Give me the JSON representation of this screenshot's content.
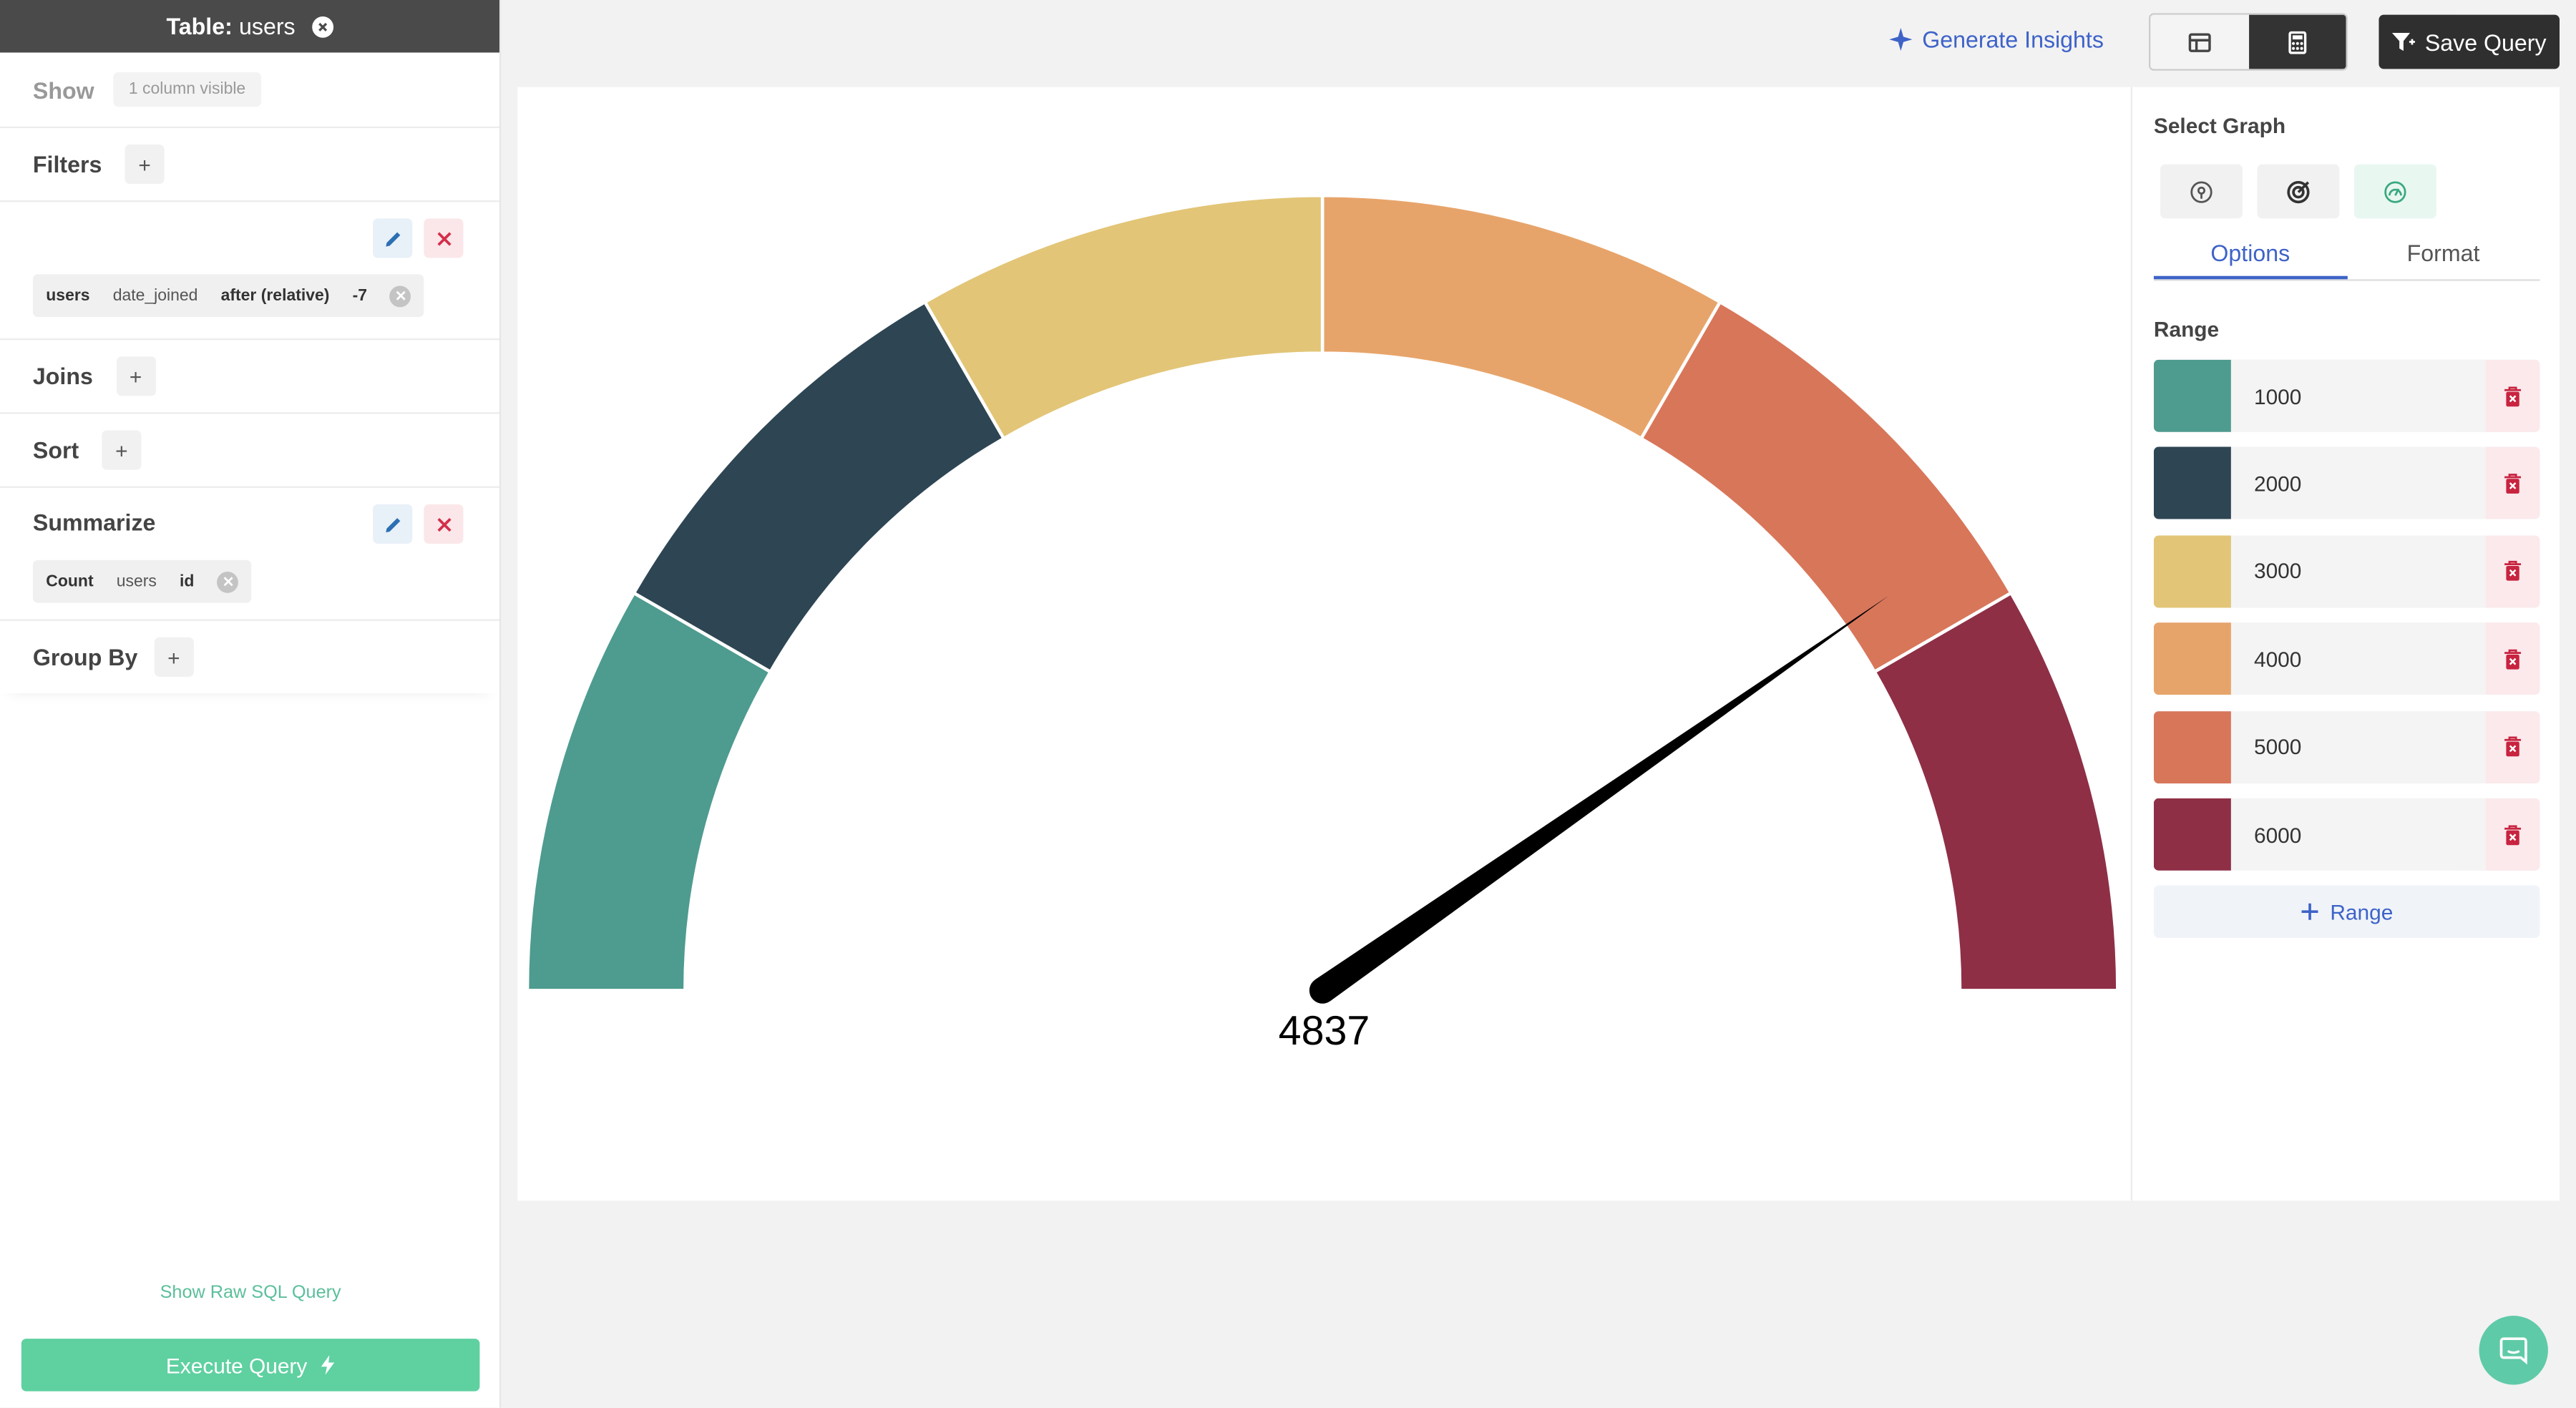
{
  "sidebar": {
    "table_prefix": "Table:",
    "table_name": "users",
    "show_label": "Show",
    "show_value": "1 column visible",
    "filters_label": "Filters",
    "filter_tag": {
      "table": "users",
      "column": "date_joined",
      "operator": "after (relative)",
      "value": "-7"
    },
    "joins_label": "Joins",
    "sort_label": "Sort",
    "summarize_label": "Summarize",
    "summarize_tag": {
      "fn": "Count",
      "table": "users",
      "column": "id"
    },
    "group_by_label": "Group By",
    "raw_sql_link": "Show Raw SQL Query",
    "execute_label": "Execute Query"
  },
  "toolbar": {
    "insights_label": "Generate Insights",
    "save_label": "Save Query"
  },
  "chart_data": {
    "type": "gauge",
    "value": 4837,
    "display_value": "4837",
    "min": 0,
    "max": 6000,
    "bands": [
      {
        "to": 1000,
        "color": "#4e9b8f"
      },
      {
        "to": 2000,
        "color": "#2e4553"
      },
      {
        "to": 3000,
        "color": "#e2c577"
      },
      {
        "to": 4000,
        "color": "#e7a46a"
      },
      {
        "to": 5000,
        "color": "#d8765a"
      },
      {
        "to": 6000,
        "color": "#8e2f46"
      }
    ]
  },
  "options": {
    "select_graph_label": "Select Graph",
    "graph_types": [
      "pin-icon",
      "target-icon",
      "gauge-icon"
    ],
    "tab_options": "Options",
    "tab_format": "Format",
    "range_label": "Range",
    "ranges": [
      {
        "value": "1000",
        "color": "#4e9b8f"
      },
      {
        "value": "2000",
        "color": "#2e4553"
      },
      {
        "value": "3000",
        "color": "#e2c577"
      },
      {
        "value": "4000",
        "color": "#e7a46a"
      },
      {
        "value": "5000",
        "color": "#d8765a"
      },
      {
        "value": "6000",
        "color": "#8e2f46"
      }
    ],
    "add_range_label": "Range"
  }
}
